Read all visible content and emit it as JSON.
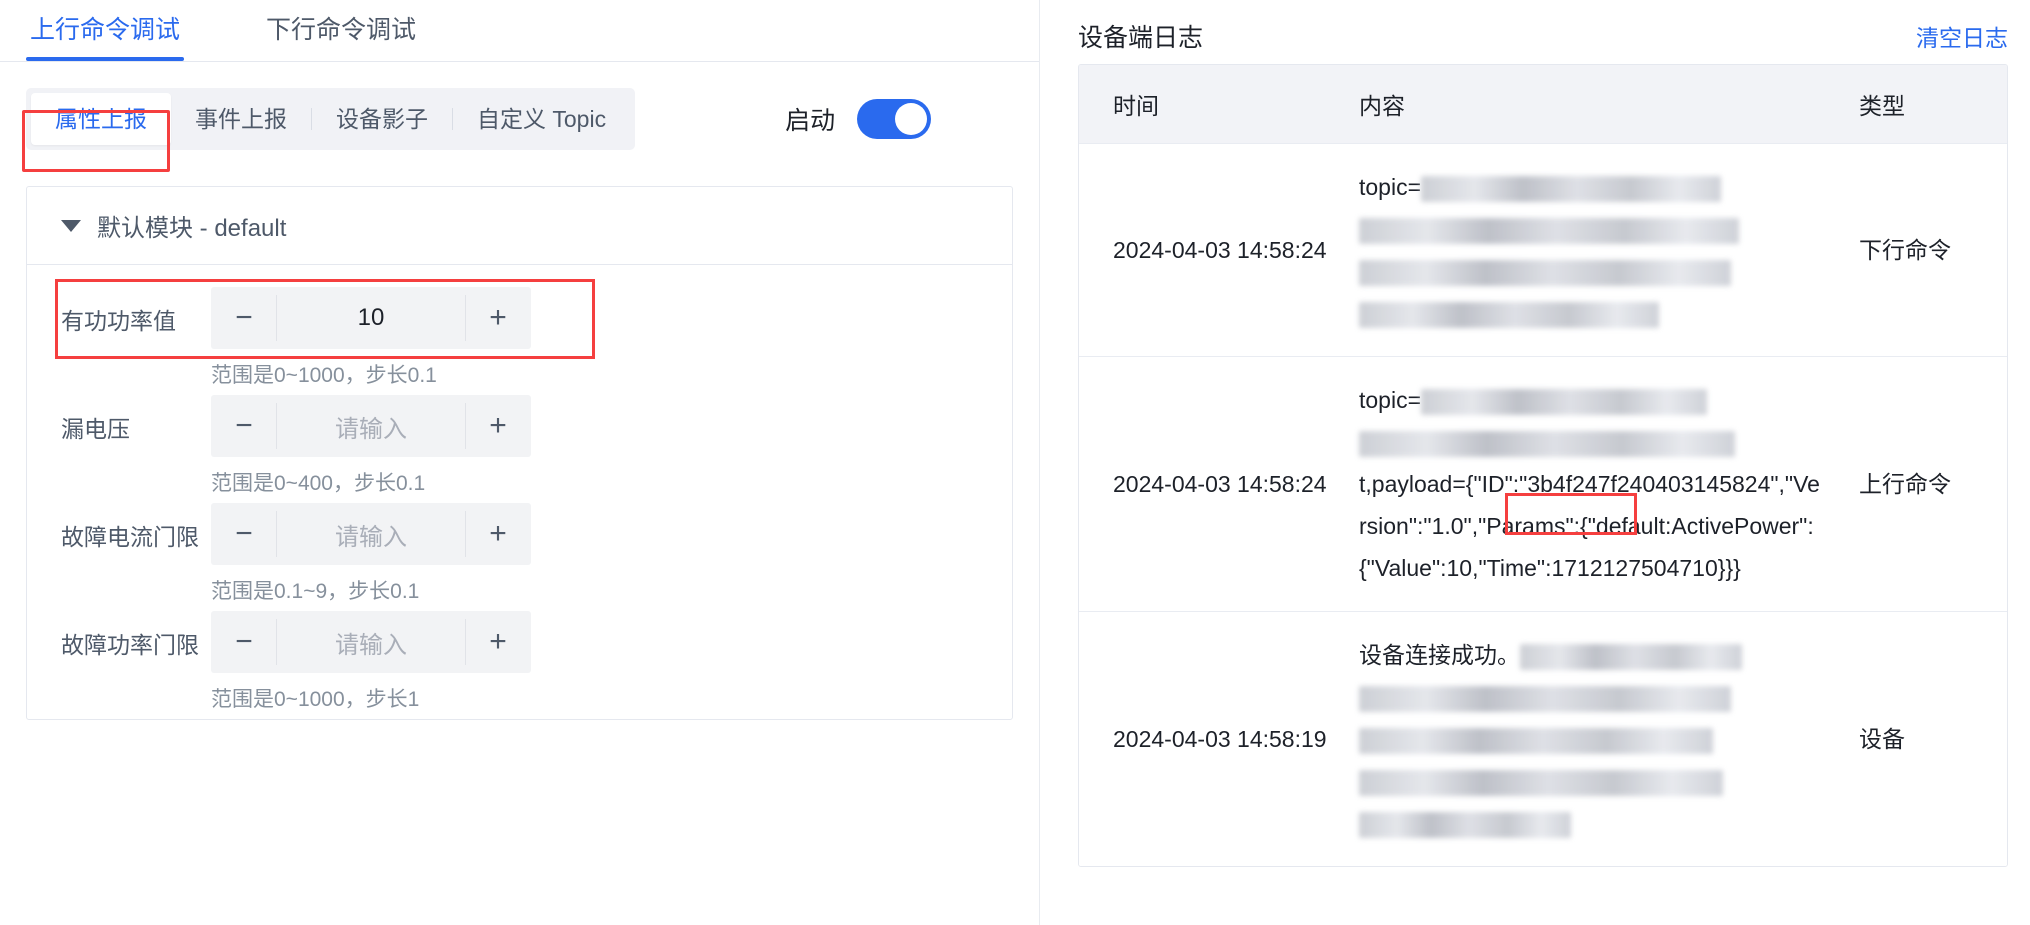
{
  "main_tabs": [
    {
      "label": "上行命令调试",
      "active": true
    },
    {
      "label": "下行命令调试",
      "active": false
    }
  ],
  "sub_tabs": [
    {
      "label": "属性上报",
      "active": true
    },
    {
      "label": "事件上报",
      "active": false
    },
    {
      "label": "设备影子",
      "active": false
    },
    {
      "label": "自定义 Topic",
      "active": false
    }
  ],
  "toggle": {
    "label": "启动",
    "state": "on",
    "color": "#2a6aee"
  },
  "module": {
    "title": "默认模块 - default",
    "expanded": true,
    "properties": [
      {
        "label": "有功功率值",
        "value": "10",
        "is_placeholder": false,
        "hint": "范围是0~1000，步长0.1",
        "minus": "−",
        "plus": "+",
        "highlighted": true
      },
      {
        "label": "漏电压",
        "value": "请输入",
        "is_placeholder": true,
        "hint": "范围是0~400，步长0.1",
        "minus": "−",
        "plus": "+",
        "highlighted": false
      },
      {
        "label": "故障电流门限",
        "value": "请输入",
        "is_placeholder": true,
        "hint": "范围是0.1~9，步长0.1",
        "minus": "−",
        "plus": "+",
        "highlighted": false
      },
      {
        "label": "故障功率门限",
        "value": "请输入",
        "is_placeholder": true,
        "hint": "范围是0~1000，步长1",
        "minus": "−",
        "plus": "+",
        "highlighted": false
      }
    ]
  },
  "log_panel": {
    "title": "设备端日志",
    "clear_label": "清空日志",
    "columns": [
      "时间",
      "内容",
      "类型"
    ],
    "rows": [
      {
        "time": "2024-04-03 14:58:24",
        "content_prefix": "topic=",
        "content_redacted": true,
        "content_text": "",
        "type": "下行命令"
      },
      {
        "time": "2024-04-03 14:58:24",
        "content_prefix": "topic=",
        "content_redacted": true,
        "content_text": "t,payload={\"ID\":\"3b4f247f240403145824\",\"Version\":\"1.0\",\"Params\":{\"default:ActivePower\":{\"Value\":10,\"Time\":1712127504710}}}",
        "highlight_fragment": "{\"Value\":10,",
        "type": "上行命令"
      },
      {
        "time": "2024-04-03 14:58:19",
        "content_prefix": "设备连接成功。",
        "content_redacted": true,
        "content_text": "",
        "type": "设备"
      }
    ]
  },
  "highlight_color": "#f53f3f"
}
